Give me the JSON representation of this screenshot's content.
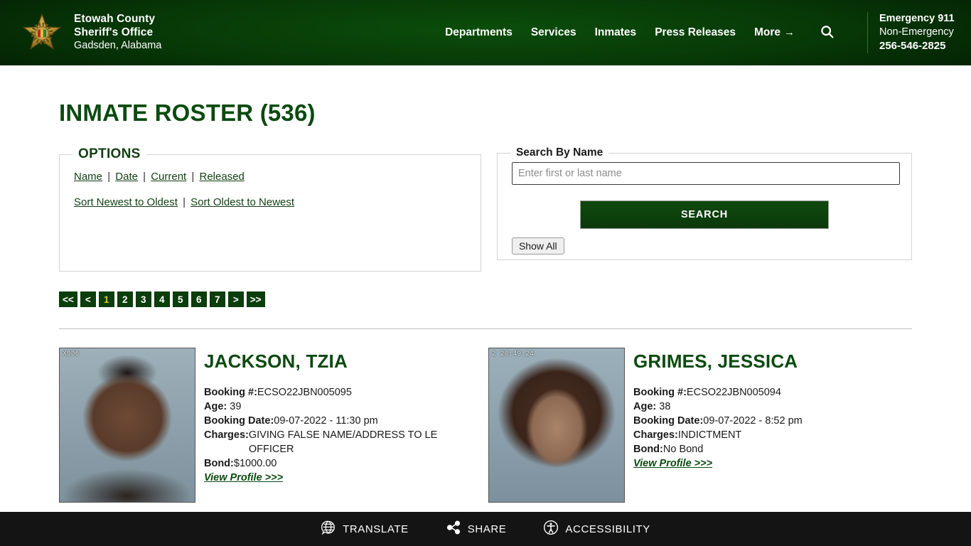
{
  "header": {
    "logo_icon": "sheriff-star-badge-icon",
    "brand_line1": "Etowah County",
    "brand_line2": "Sheriff's Office",
    "brand_line3": "Gadsden, Alabama",
    "nav": [
      {
        "label": "Departments"
      },
      {
        "label": "Services"
      },
      {
        "label": "Inmates"
      },
      {
        "label": "Press Releases"
      }
    ],
    "more_label": "More",
    "more_arrow": "→",
    "search_icon": "search-icon",
    "emergency": {
      "line1": "Emergency 911",
      "line2": "Non-Emergency",
      "line3": "256-546-2825"
    }
  },
  "main": {
    "title": "INMATE ROSTER (536)"
  },
  "options": {
    "legend": "OPTIONS",
    "filter_links": [
      "Name",
      "Date",
      "Current",
      "Released"
    ],
    "sort_links": [
      "Sort Newest to Oldest",
      "Sort Oldest to Newest"
    ],
    "separator": "|"
  },
  "search": {
    "legend": "Search By Name",
    "placeholder": "Enter first or last name",
    "value": "",
    "submit_label": "SEARCH",
    "show_all_label": "Show All"
  },
  "pagination": {
    "items": [
      {
        "label": "<<",
        "active": false
      },
      {
        "label": "<",
        "active": false
      },
      {
        "label": "1",
        "active": true
      },
      {
        "label": "2",
        "active": false
      },
      {
        "label": "3",
        "active": false
      },
      {
        "label": "4",
        "active": false
      },
      {
        "label": "5",
        "active": false
      },
      {
        "label": "6",
        "active": false
      },
      {
        "label": "7",
        "active": false
      },
      {
        "label": ">",
        "active": false
      },
      {
        "label": ">>",
        "active": false
      }
    ]
  },
  "roster": {
    "labels": {
      "booking": "Booking #:",
      "age": "Age:",
      "booking_date": "Booking Date:",
      "charges": "Charges:",
      "bond": "Bond:",
      "view_profile": "View Profile >>>"
    },
    "inmates": [
      {
        "name": "JACKSON, TZIA",
        "booking_number": "ECSO22JBN005095",
        "age": "39",
        "booking_date": "09-07-2022 - 11:30 pm",
        "charges": "GIVING FALSE NAME/ADDRESS TO LE OFFICER",
        "bond": "$1000.00",
        "mug_stamp": "X006"
      },
      {
        "name": "GRIMES, JESSICA",
        "booking_number": "ECSO22JBN005094",
        "age": "38",
        "booking_date": "09-07-2022 - 8:52 pm",
        "charges": "INDICTMENT",
        "bond": "No Bond",
        "mug_stamp": "2   20:49:24"
      }
    ]
  },
  "bottom_bar": {
    "items": [
      {
        "label": "TRANSLATE",
        "icon": "globe-translate-icon"
      },
      {
        "label": "SHARE",
        "icon": "share-nodes-icon"
      },
      {
        "label": "ACCESSIBILITY",
        "icon": "accessibility-person-icon"
      }
    ]
  },
  "colors": {
    "header_green": "#0b4d0b",
    "brand_green": "#0b4a10",
    "accent_gold": "#d8c23c",
    "bottom_bar": "#141414"
  }
}
